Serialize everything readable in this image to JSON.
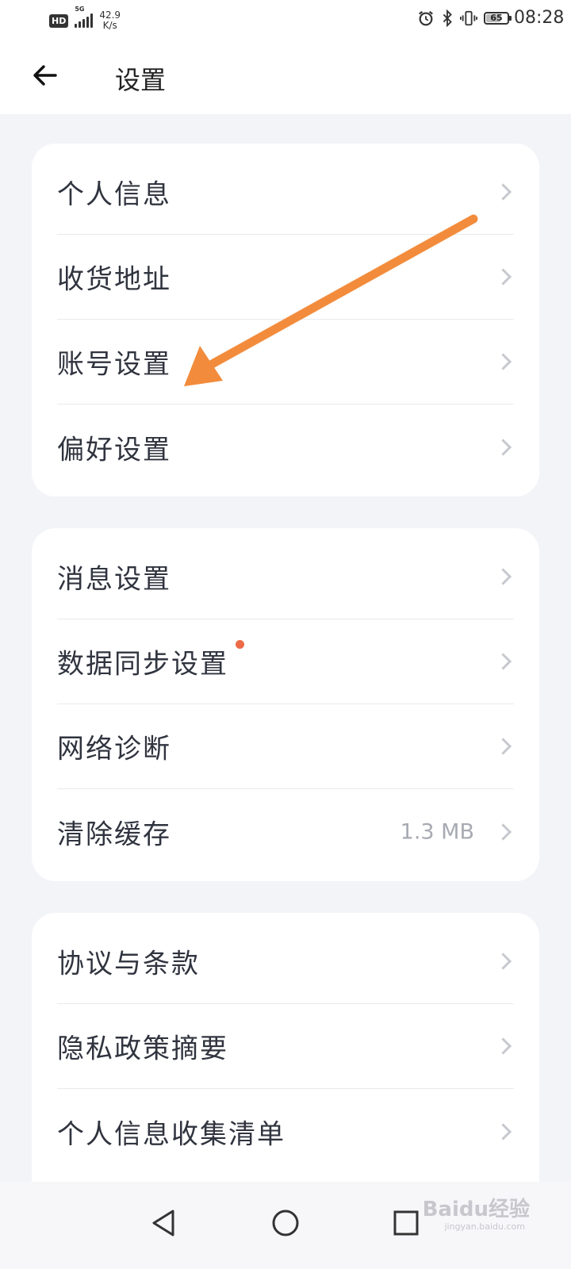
{
  "status_bar": {
    "hd_label": "HD",
    "network_label": "5G",
    "speed_value": "42.9",
    "speed_unit": "K/s",
    "battery_level": "65",
    "time": "08:28"
  },
  "header": {
    "title": "设置"
  },
  "section1": {
    "items": [
      {
        "label": "个人信息"
      },
      {
        "label": "收货地址"
      },
      {
        "label": "账号设置"
      },
      {
        "label": "偏好设置"
      }
    ]
  },
  "section2": {
    "items": [
      {
        "label": "消息设置"
      },
      {
        "label": "数据同步设置"
      },
      {
        "label": "网络诊断"
      },
      {
        "label": "清除缓存",
        "value": "1.3 MB"
      }
    ]
  },
  "section3": {
    "items": [
      {
        "label": "协议与条款"
      },
      {
        "label": "隐私政策摘要"
      },
      {
        "label": "个人信息收集清单"
      }
    ]
  },
  "watermark": {
    "text": "Baidu经验",
    "url_text": "jingyan.baidu.com"
  },
  "colors": {
    "background": "#f3f4f8",
    "card": "#ffffff",
    "arrow": "#f28c3c",
    "badge_dot": "#ee6a47",
    "chevron": "#c7c9cf"
  },
  "icons": [
    "back-arrow-icon",
    "chevron-right-icon",
    "alarm-icon",
    "bluetooth-icon",
    "vibrate-icon",
    "battery-icon",
    "nav-back-icon",
    "nav-home-icon",
    "nav-recents-icon"
  ]
}
